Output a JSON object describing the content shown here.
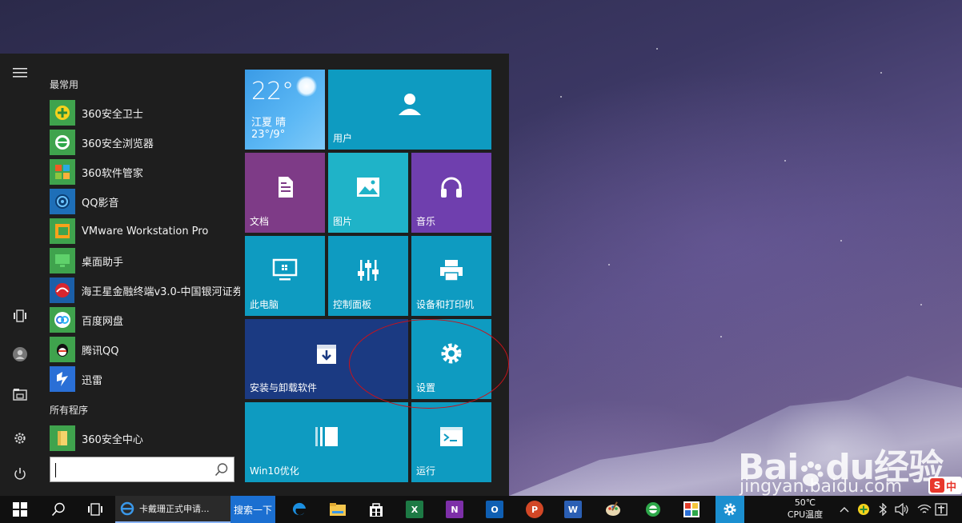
{
  "start_menu": {
    "most_used_title": "最常用",
    "all_programs_title": "所有程序",
    "most_used": [
      {
        "label": "360安全卫士",
        "icon": "360-safe-icon",
        "color": "#3fa34d"
      },
      {
        "label": "360安全浏览器",
        "icon": "360-browser-icon",
        "color": "#3fa34d"
      },
      {
        "label": "360软件管家",
        "icon": "360-software-manager-icon",
        "color": "#3fa34d"
      },
      {
        "label": "QQ影音",
        "icon": "qq-player-icon",
        "color": "#1e6fb8"
      },
      {
        "label": "VMware Workstation Pro",
        "icon": "vmware-icon",
        "color": "#3fa34d"
      },
      {
        "label": "桌面助手",
        "icon": "desktop-assistant-icon",
        "color": "#3fa34d"
      },
      {
        "label": "海王星金融终端v3.0-中国银河证券",
        "icon": "neptune-finance-icon",
        "color": "#1b5fa8"
      },
      {
        "label": "百度网盘",
        "icon": "baidu-netdisk-icon",
        "color": "#3fa34d"
      },
      {
        "label": "腾讯QQ",
        "icon": "tencent-qq-icon",
        "color": "#3fa34d"
      },
      {
        "label": "迅雷",
        "icon": "thunder-icon",
        "color": "#2a6fd6"
      }
    ],
    "all_programs": [
      {
        "label": "360安全中心",
        "icon": "folder-icon",
        "color": "#3fa34d"
      }
    ]
  },
  "tiles": {
    "weather": {
      "temp": "22°",
      "city": "江夏 晴",
      "range": "23°/9°"
    },
    "user": "用户",
    "documents": "文档",
    "pictures": "图片",
    "music": "音乐",
    "this_pc": "此电脑",
    "control_panel": "控制面板",
    "devices_printers": "设备和打印机",
    "install_uninstall": "安装与卸载软件",
    "settings": "设置",
    "win10_optimize": "Win10优化",
    "run": "运行"
  },
  "taskbar": {
    "ie_window_title": "卡戴珊正式申请...",
    "search_button": "搜索一下",
    "cpu_temp": "50℃",
    "cpu_label": "CPU温度"
  },
  "watermark": {
    "brand": "Bai",
    "brand_du": "du",
    "brand_cn": "经验",
    "url": "jingyan.baidu.com",
    "sogou_s": "S",
    "sogou_zh": "中"
  }
}
